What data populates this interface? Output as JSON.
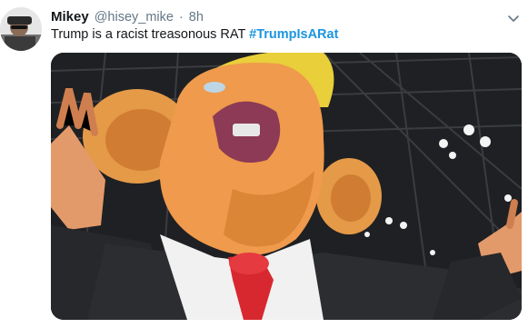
{
  "tweet": {
    "display_name": "Mikey",
    "handle": "@hisey_mike",
    "separator": "·",
    "time": "8h",
    "text": "Trump is a racist treasonous RAT",
    "hashtag": "#TrumpIsARat"
  },
  "icons": {
    "menu": "chevron-down-icon",
    "avatar": "profile-avatar"
  },
  "colors": {
    "name": "#14171a",
    "secondary": "#657786",
    "hashtag": "#1b95e0"
  }
}
